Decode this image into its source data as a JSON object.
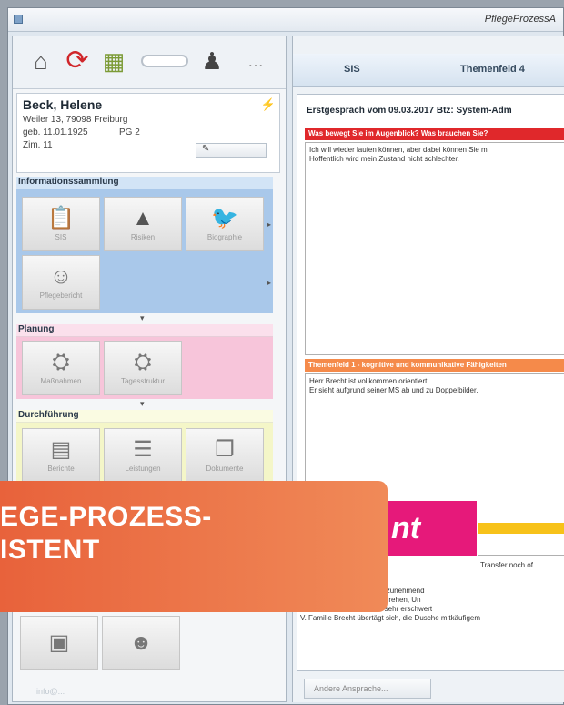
{
  "window": {
    "title": "PflegeProzessA"
  },
  "toolbar": {
    "icons": [
      "house-icon",
      "cycle-icon",
      "calendar-icon",
      "toggle-icon",
      "stamp-icon",
      "more-icon"
    ]
  },
  "patient": {
    "name": "Beck, Helene",
    "address": "Weiler 13, 79098 Freiburg",
    "dob": "geb. 11.01.1925",
    "pg": "PG 2",
    "room": "Zim. 11",
    "button_label": "✎"
  },
  "sections": {
    "info": {
      "title": "Informationssammlung",
      "tiles": [
        "SIS",
        "Risiken",
        "Biographie",
        "Pflegebericht"
      ]
    },
    "planung": {
      "title": "Planung",
      "tiles": [
        "Maßnahmen",
        "Tagesstruktur"
      ]
    },
    "durchfuehrung": {
      "title": "Durchführung",
      "tiles": [
        "Berichte",
        "Leistungen",
        "Dokumente"
      ]
    }
  },
  "footer": {
    "link": "info@..."
  },
  "tabs": {
    "sis": "SIS",
    "tf4": "Themenfeld 4"
  },
  "content": {
    "header": "Erstgespräch vom 09.03.2017 Btz: System-Adm",
    "red_bar": "Was bewegt Sie im Augenblick? Was brauchen Sie?",
    "box1": [
      "Ich will wieder laufen können, aber dabei können Sie m",
      "Hoffentlich wird mein Zustand nicht schlechter."
    ],
    "orange_bar": "Themenfeld 1 - kognitive und kommunikative Fähigkeiten",
    "box2": [
      "Herr Brecht ist vollkommen orientiert.",
      "Er sieht aufgrund seiner MS ab und zu Doppelbilder."
    ],
    "badge_text": "nt",
    "transfer": "Transfer noch of",
    "more": [
      "...ungen im Sitzen werden zunehmend",
      "...nicht mehr auf die Seite drehen, Un",
      "Transfer in die Dusche ist sehr erschwert",
      "V. Familie Brecht übertägt sich, die Dusche mitkäufigem"
    ],
    "bottom_button": "Andere Ansprache..."
  },
  "banner": {
    "line1": "EGE-PROZESS-",
    "line2": "ISTENT"
  }
}
